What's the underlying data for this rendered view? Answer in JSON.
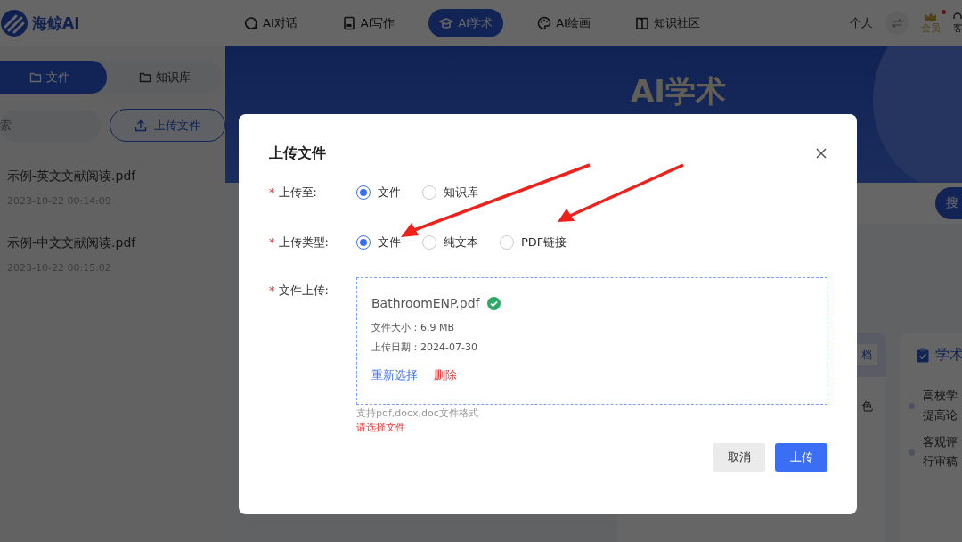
{
  "header": {
    "logo": "海鲸AI",
    "nav": [
      {
        "label": "AI对话",
        "selected": false
      },
      {
        "label": "AI写作",
        "selected": false
      },
      {
        "label": "AI学术",
        "selected": true
      },
      {
        "label": "AI绘画",
        "selected": false
      },
      {
        "label": "知识社区",
        "selected": false
      }
    ],
    "user": "个人",
    "member": "会员",
    "service": "客"
  },
  "sidebar": {
    "tabs": [
      {
        "label": "文件",
        "selected": true
      },
      {
        "label": "知识库",
        "selected": false
      }
    ],
    "search": {
      "placeholder": "索"
    },
    "upload_button": "上传文件",
    "files": [
      {
        "name": "示例-英文文献阅读.pdf",
        "date": "2023-10-22 00:14:09"
      },
      {
        "name": "示例-中文文献阅读.pdf",
        "date": "2023-10-22 00:15:02"
      }
    ]
  },
  "hero": {
    "title": "AI学术",
    "search_button": "搜"
  },
  "cards": [
    {
      "tab_button": "档",
      "lines": [
        "色"
      ]
    },
    {
      "title": "学术",
      "items": [
        [
          "高校学",
          "提高论"
        ],
        [
          "客观评",
          "行审稿"
        ]
      ]
    }
  ],
  "dialog": {
    "title": "上传文件",
    "fields": [
      {
        "label": "上传至:",
        "required_mark": "*",
        "kind": "radio",
        "options": [
          {
            "label": "文件",
            "selected": true
          },
          {
            "label": "知识库",
            "selected": false
          }
        ]
      },
      {
        "label": "上传类型:",
        "required_mark": "*",
        "kind": "radio",
        "options": [
          {
            "label": "文件",
            "selected": true
          },
          {
            "label": "纯文本",
            "selected": false
          },
          {
            "label": "PDF链接",
            "selected": false
          }
        ]
      },
      {
        "label": "文件上传:",
        "required_mark": "*",
        "kind": "upload",
        "file": {
          "name": "BathroomENP.pdf",
          "uploaded": true,
          "size": "文件大小：6.9 MB",
          "date": "上传日期：2024-07-30",
          "reselect": "重新选择",
          "delete": "删除"
        },
        "hint": "支持pdf,docx,doc文件格式",
        "error": "请选择文件"
      }
    ],
    "buttons": [
      {
        "label": "取消",
        "kind": "secondary"
      },
      {
        "label": "上传",
        "kind": "primary"
      }
    ]
  }
}
